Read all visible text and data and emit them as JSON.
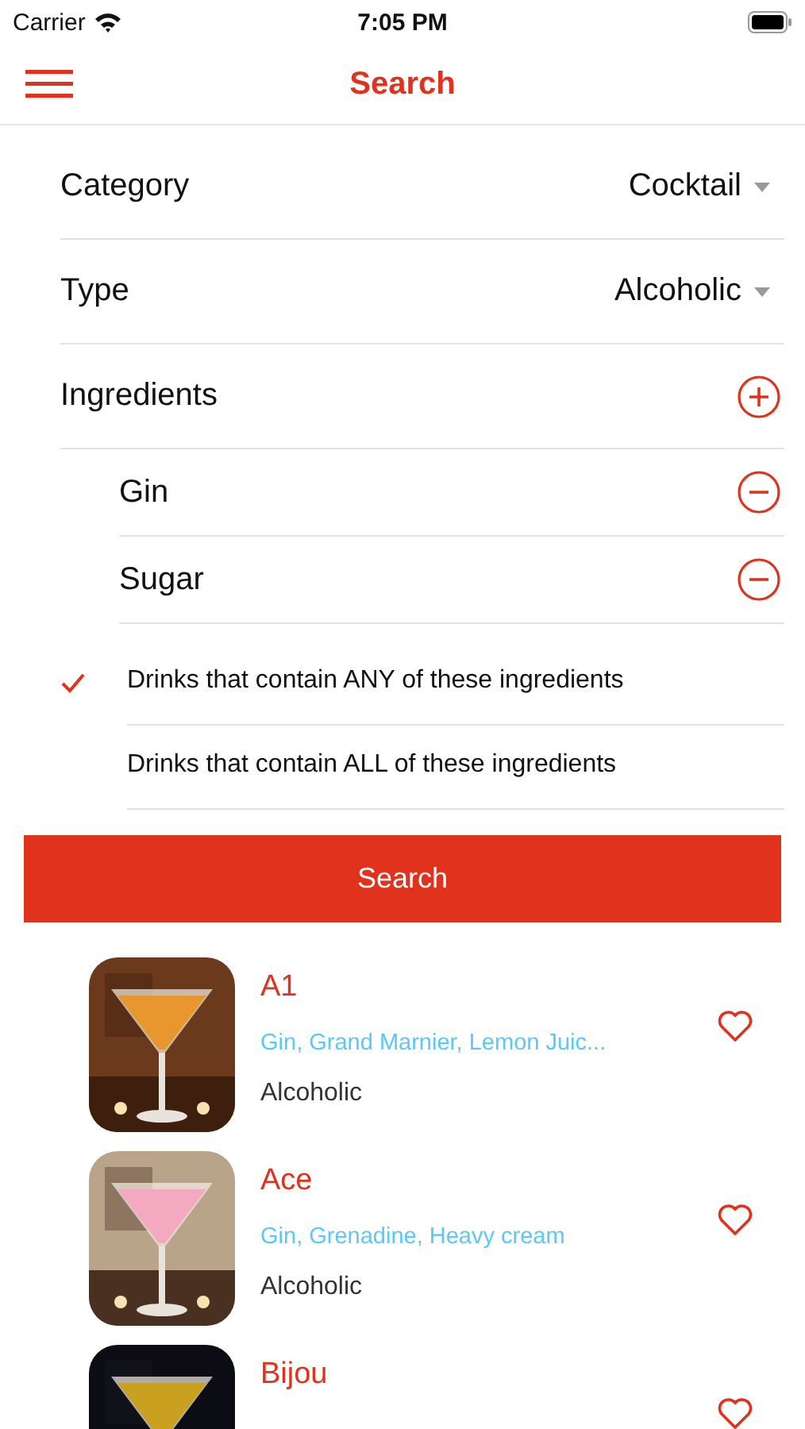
{
  "status_bar": {
    "carrier": "Carrier",
    "time": "7:05 PM"
  },
  "nav": {
    "title": "Search"
  },
  "filters": [
    {
      "label": "Category",
      "value": "Cocktail"
    },
    {
      "label": "Type",
      "value": "Alcoholic"
    }
  ],
  "ingredients": {
    "label": "Ingredients",
    "items": [
      "Gin",
      "Sugar"
    ]
  },
  "match_options": [
    {
      "label": "Drinks that contain ANY of these ingredients",
      "selected": true
    },
    {
      "label": "Drinks that contain ALL of these ingredients",
      "selected": false
    }
  ],
  "search_button": "Search",
  "results": [
    {
      "name": "A1",
      "ingredients": "Gin, Grand Marnier, Lemon Juic...",
      "type": "Alcoholic"
    },
    {
      "name": "Ace",
      "ingredients": "Gin, Grenadine, Heavy cream",
      "type": "Alcoholic"
    },
    {
      "name": "Bijou"
    }
  ]
}
